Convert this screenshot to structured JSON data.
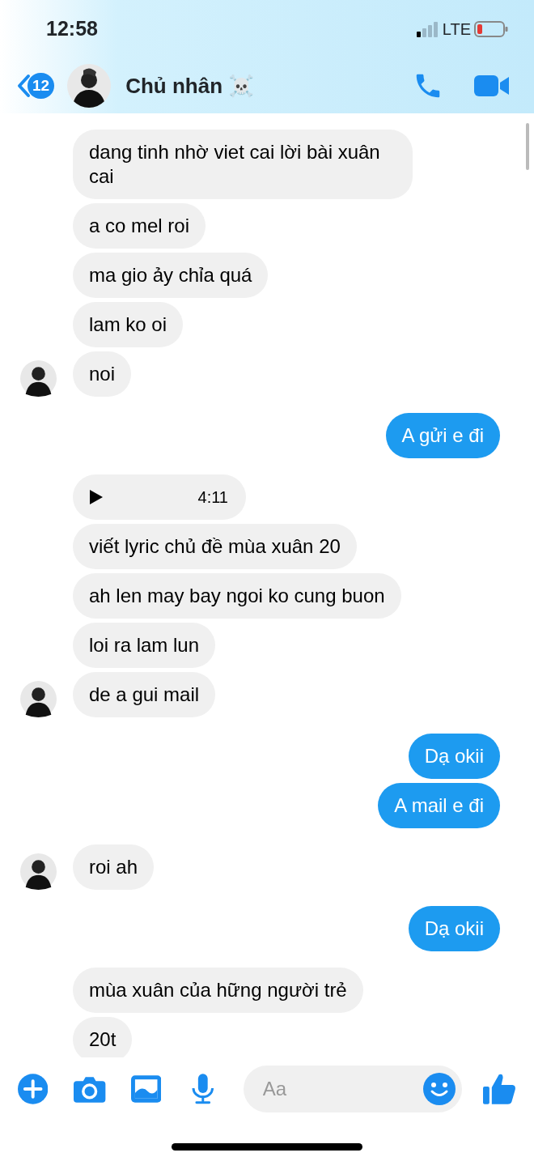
{
  "status_bar": {
    "time": "12:58",
    "network": "LTE"
  },
  "header": {
    "unread_count": "12",
    "contact_name": "Chủ nhân ☠️"
  },
  "messages": [
    {
      "kind": "text",
      "outgoing": false,
      "avatar": false,
      "text": "dang tinh nhờ viet cai lời bài xuân cai"
    },
    {
      "kind": "text",
      "outgoing": false,
      "avatar": false,
      "text": "a co mel roi"
    },
    {
      "kind": "text",
      "outgoing": false,
      "avatar": false,
      "text": "ma gio ảy chỉa quá"
    },
    {
      "kind": "text",
      "outgoing": false,
      "avatar": false,
      "text": "lam ko oi"
    },
    {
      "kind": "text",
      "outgoing": false,
      "avatar": true,
      "text": "noi"
    },
    {
      "kind": "text",
      "outgoing": true,
      "avatar": false,
      "text": "A gửi e đi"
    },
    {
      "kind": "audio",
      "outgoing": false,
      "avatar": false,
      "duration": "4:11"
    },
    {
      "kind": "text",
      "outgoing": false,
      "avatar": false,
      "text": "viết lyric chủ đề mùa xuân 20"
    },
    {
      "kind": "text",
      "outgoing": false,
      "avatar": false,
      "text": "ah len may bay ngoi ko cung buon"
    },
    {
      "kind": "text",
      "outgoing": false,
      "avatar": false,
      "text": "loi ra lam lun"
    },
    {
      "kind": "text",
      "outgoing": false,
      "avatar": true,
      "text": "de a gui mail"
    },
    {
      "kind": "text",
      "outgoing": true,
      "avatar": false,
      "text": "Dạ okii"
    },
    {
      "kind": "text",
      "outgoing": true,
      "avatar": false,
      "text": "A mail e đi"
    },
    {
      "kind": "text",
      "outgoing": false,
      "avatar": true,
      "text": "roi ah"
    },
    {
      "kind": "text",
      "outgoing": true,
      "avatar": false,
      "text": "Dạ okii"
    },
    {
      "kind": "text",
      "outgoing": false,
      "avatar": false,
      "text": "mùa xuân của hững người trẻ"
    },
    {
      "kind": "text",
      "outgoing": false,
      "avatar": false,
      "text": "20t"
    }
  ],
  "composer": {
    "placeholder": "Aa"
  }
}
